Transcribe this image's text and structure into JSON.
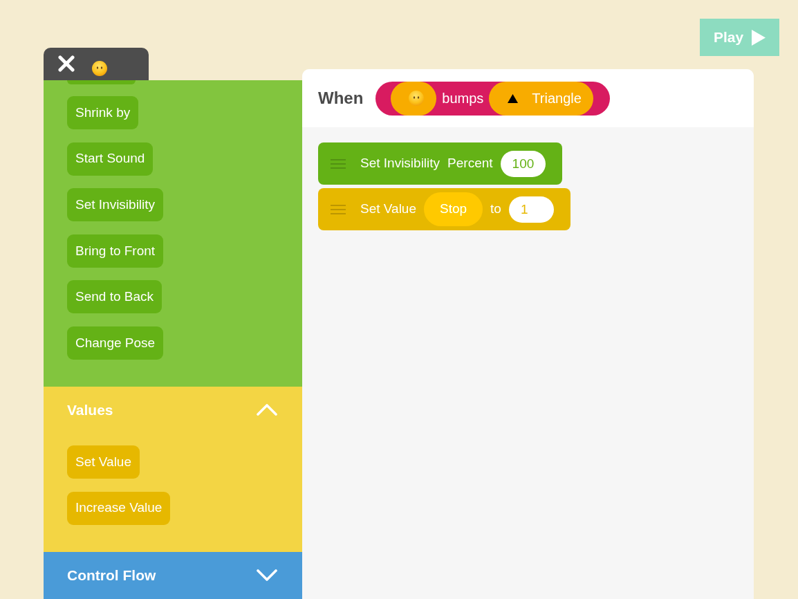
{
  "play_button": {
    "label": "Play"
  },
  "palette": {
    "sections": [
      {
        "color": "#82c53e",
        "blocks": [
          {
            "label": "Shrink by",
            "color": "#64b216"
          },
          {
            "label": "Start Sound",
            "color": "#64b216"
          },
          {
            "label": "Set Invisibility",
            "color": "#64b216"
          },
          {
            "label": "Bring to Front",
            "color": "#64b216"
          },
          {
            "label": "Send to Back",
            "color": "#64b216"
          },
          {
            "label": "Change Pose",
            "color": "#64b216"
          }
        ]
      },
      {
        "title": "Values",
        "color": "#f3d544",
        "expanded": true,
        "blocks": [
          {
            "label": "Set Value",
            "color": "#e6b800"
          },
          {
            "label": "Increase Value",
            "color": "#e6b800"
          }
        ]
      },
      {
        "title": "Control Flow",
        "color": "#4a9bd8",
        "expanded": false
      }
    ]
  },
  "script": {
    "trigger": {
      "label": "When",
      "event": "bumps",
      "target": "Triangle"
    },
    "blocks": [
      {
        "label": "Set Invisibility",
        "color": "#64b216",
        "parts": [
          {
            "kind": "text",
            "text": "Percent"
          },
          {
            "kind": "input",
            "value": "100"
          }
        ]
      },
      {
        "label": "Set Value",
        "color": "#e6b800",
        "parts": [
          {
            "kind": "pill",
            "text": "Stop"
          },
          {
            "kind": "text",
            "text": "to"
          },
          {
            "kind": "input",
            "value": "1"
          }
        ]
      }
    ]
  }
}
